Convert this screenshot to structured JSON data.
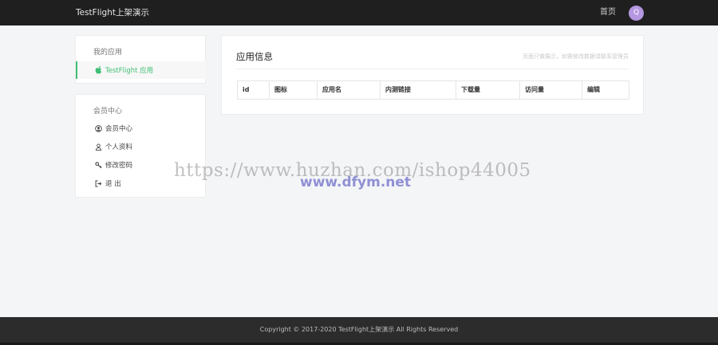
{
  "header": {
    "brand": "TestFlight上架演示",
    "home_link": "首页",
    "avatar_letter": "Q",
    "avatar_color": "#b596e0"
  },
  "sidebar": {
    "app_section": {
      "title": "我的应用",
      "items": [
        {
          "label": "TestFlight 应用",
          "icon": "apple-icon",
          "active": true
        }
      ]
    },
    "member_section": {
      "title": "会员中心",
      "items": [
        {
          "label": "会员中心",
          "icon": "user-circle-icon"
        },
        {
          "label": "个人资料",
          "icon": "user-icon"
        },
        {
          "label": "修改密码",
          "icon": "key-icon"
        },
        {
          "label": "退 出",
          "icon": "logout-icon"
        }
      ]
    }
  },
  "main": {
    "title": "应用信息",
    "note": "页面只做展示，如需修改数据请联系管理员",
    "table": {
      "columns": [
        "id",
        "图标",
        "应用名",
        "内测链接",
        "下载量",
        "访问量",
        "编辑"
      ]
    }
  },
  "footer": {
    "copyright": "Copyright © 2017-2020 TestFlight上架演示 All Rights Reserved"
  },
  "watermark": {
    "url": "https://www.huzhan.com/ishop44005",
    "site": "www.dfym.net"
  },
  "colors": {
    "accent": "#3fbf73",
    "topbar": "#1f1f1f",
    "footer": "#2c2c2c"
  }
}
